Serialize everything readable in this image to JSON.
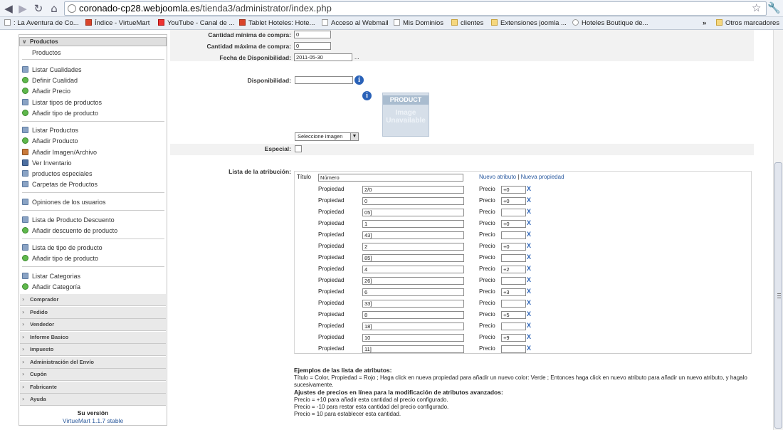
{
  "browser": {
    "url_host": "coronado-cp28.webjoomla.es",
    "url_path": "/tienda3/administrator/index.php",
    "bookmarks": [
      ": La Aventura de Co...",
      "Índice - VirtueMart",
      "YouTube - Canal de ...",
      "Tablet Hoteles: Hote...",
      "Acceso al Webmail",
      "Mis Dominios",
      "clientes",
      "Extensiones joomla ...",
      "Hoteles Boutique de..."
    ],
    "other_bookmarks": "Otros marcadores",
    "overflow": "»"
  },
  "sidebar": {
    "header": "Productos",
    "subheader": "Productos",
    "groups": [
      [
        "Listar Cualidades",
        "Definir Cualidad",
        "Añadir Precio",
        "Listar tipos de productos",
        "Añadir tipo de producto"
      ],
      [
        "Listar Productos",
        "Añadir Producto",
        "Añadir Imagen/Archivo",
        "Ver Inventario",
        "productos especiales",
        "Carpetas de Productos"
      ],
      [
        "Opiniones de los usuarios"
      ],
      [
        "Lista de Producto Descuento",
        "Añadir descuento de producto"
      ],
      [
        "Lista de tipo de producto",
        "Añadir tipo de producto"
      ],
      [
        "Listar Categorias",
        "Añadir Categoría"
      ]
    ],
    "collapsed": [
      "Comprador",
      "Pedido",
      "Vendedor",
      "Informe Basico",
      "Impuesto",
      "Administración del Envío",
      "Cupón",
      "Fabricante",
      "Ayuda"
    ],
    "version_title": "Su versión",
    "version_value": "VirtueMart 1.1.7 stable"
  },
  "form": {
    "min_label": "Cantidad mínima de compra:",
    "min_value": "0",
    "max_label": "Cantidad máxima de compra:",
    "max_value": "0",
    "date_label": "Fecha de Disponibilidad:",
    "date_value": "2011-05-30",
    "date_dots": "...",
    "avail_label": "Disponibilidad:",
    "avail_value": "",
    "img_line1": "PRODUCT",
    "img_line2": "Image",
    "img_line3": "Unavailable",
    "select_image": "Seleccione imagen",
    "special_label": "Especial:",
    "attr_label": "Lista de la atribución:",
    "title_label": "Título",
    "title_value": "Número",
    "new_attr": "Nuevo atributo",
    "link_sep": "|",
    "new_prop": "Nueva propiedad",
    "prop_label": "Propiedad",
    "price_label": "Precio",
    "del": "X",
    "rows": [
      {
        "prop": "2/0",
        "price": "+0"
      },
      {
        "prop": "0",
        "price": "+0"
      },
      {
        "prop": "05]",
        "price": ""
      },
      {
        "prop": "1",
        "price": "+0"
      },
      {
        "prop": "43]",
        "price": ""
      },
      {
        "prop": "2",
        "price": "+0"
      },
      {
        "prop": "85]",
        "price": ""
      },
      {
        "prop": "4",
        "price": "+2"
      },
      {
        "prop": "26]",
        "price": ""
      },
      {
        "prop": "6",
        "price": "+3"
      },
      {
        "prop": "33]",
        "price": ""
      },
      {
        "prop": "8",
        "price": "+5"
      },
      {
        "prop": "18]",
        "price": ""
      },
      {
        "prop": "10",
        "price": "+9"
      },
      {
        "prop": "11]",
        "price": ""
      }
    ]
  },
  "notes": {
    "title1": "Ejemplos de las lista de atributos:",
    "text1": "Título = Color, Propiedad = Rojo ; Haga click en nueva propiedad para añadir un nuevo color: Verde ; Entonces haga click en nuevo atributo para añadir un nuevo atributo, y hagalo sucesivamente.",
    "title2": "Ajustes de precios en línea para la modificación de atributos avanzados:",
    "line1": "Precio = +10 para añadir esta cantidad al precio configurado.",
    "line2": "Precio = -10 para restar esta cantidad del precio configurado.",
    "line3": "Precio = 10 para establecer esta cantidad."
  },
  "icons": {
    "back": "back-arrow-icon",
    "forward": "forward-arrow-icon",
    "reload": "reload-icon",
    "home": "home-icon",
    "star": "star-icon",
    "wrench": "wrench-icon"
  }
}
